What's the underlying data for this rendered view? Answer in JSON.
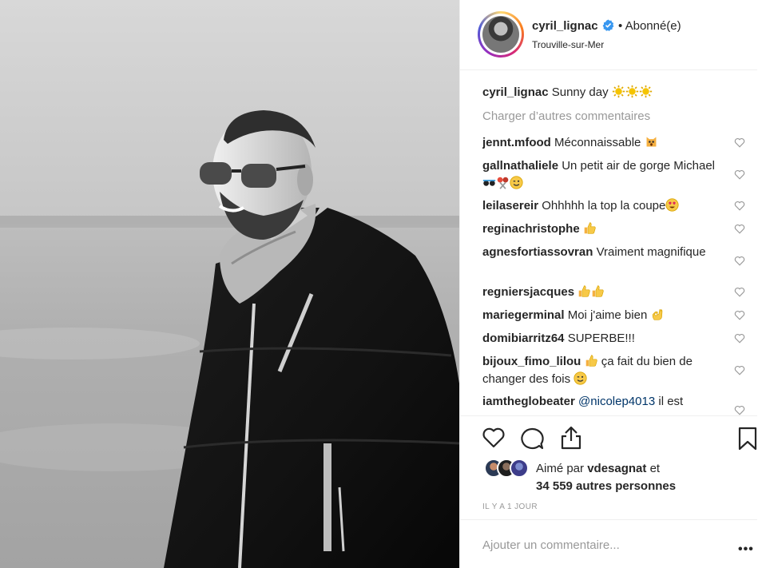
{
  "post": {
    "username": "cyril_lignac",
    "follow_status": "• Abonné(e)",
    "location": "Trouville-sur-Mer",
    "caption_user": "cyril_lignac",
    "caption_text": "Sunny day",
    "load_more": "Charger d’autres commentaires"
  },
  "comments": [
    {
      "user": "jennt.mfood",
      "text": "Méconnaissable",
      "emoji": [
        "scream-cat"
      ]
    },
    {
      "user": "gallnathaliele",
      "text": "Un petit air de gorge Michael",
      "emoji": [
        "sunglasses",
        "lollipop",
        "wink"
      ]
    },
    {
      "user": "leilasereir",
      "text": "Ohhhhh la top la coupe",
      "emoji": [
        "heart-eyes"
      ]
    },
    {
      "user": "reginachristophe",
      "text": "",
      "emoji": [
        "thumbs-up"
      ]
    },
    {
      "user": "agnesfortiassovran",
      "text": "Vraiment magnifique",
      "emoji": []
    },
    {
      "user": "regniersjacques",
      "text": "",
      "emoji": [
        "thumbs-up",
        "thumbs-up"
      ]
    },
    {
      "user": "mariegerminal",
      "text": "Moi j'aime bien",
      "emoji": [
        "ok-hand"
      ]
    },
    {
      "user": "domibiarritz64",
      "text": "SUPERBE!!!",
      "emoji": []
    },
    {
      "user": "bijoux_fimo_lilou",
      "text": "ça fait du bien de changer des fois",
      "emoji": [
        "thumbs-up",
        "wink"
      ]
    },
    {
      "user": "iamtheglobeater",
      "mention": "@nicolep4013",
      "text": "il est",
      "emoji": []
    }
  ],
  "likes": {
    "prefix": "Aimé par",
    "user": "vdesagnat",
    "suffix": "et",
    "others": "34 559 autres personnes"
  },
  "time_ago": "IL Y A 1 JOUR",
  "add_comment_placeholder": "Ajouter un commentaire...",
  "more_options": "•••",
  "icons": {
    "verified": "verified-badge-icon",
    "like": "heart-outline-icon",
    "comment": "speech-bubble-icon",
    "share": "share-upload-icon",
    "save": "bookmark-icon",
    "options": "ellipsis-icon"
  },
  "colors": {
    "text": "#262626",
    "muted": "#999999",
    "verified_blue": "#3897f0",
    "mention": "#003569",
    "divider": "#efefef"
  }
}
